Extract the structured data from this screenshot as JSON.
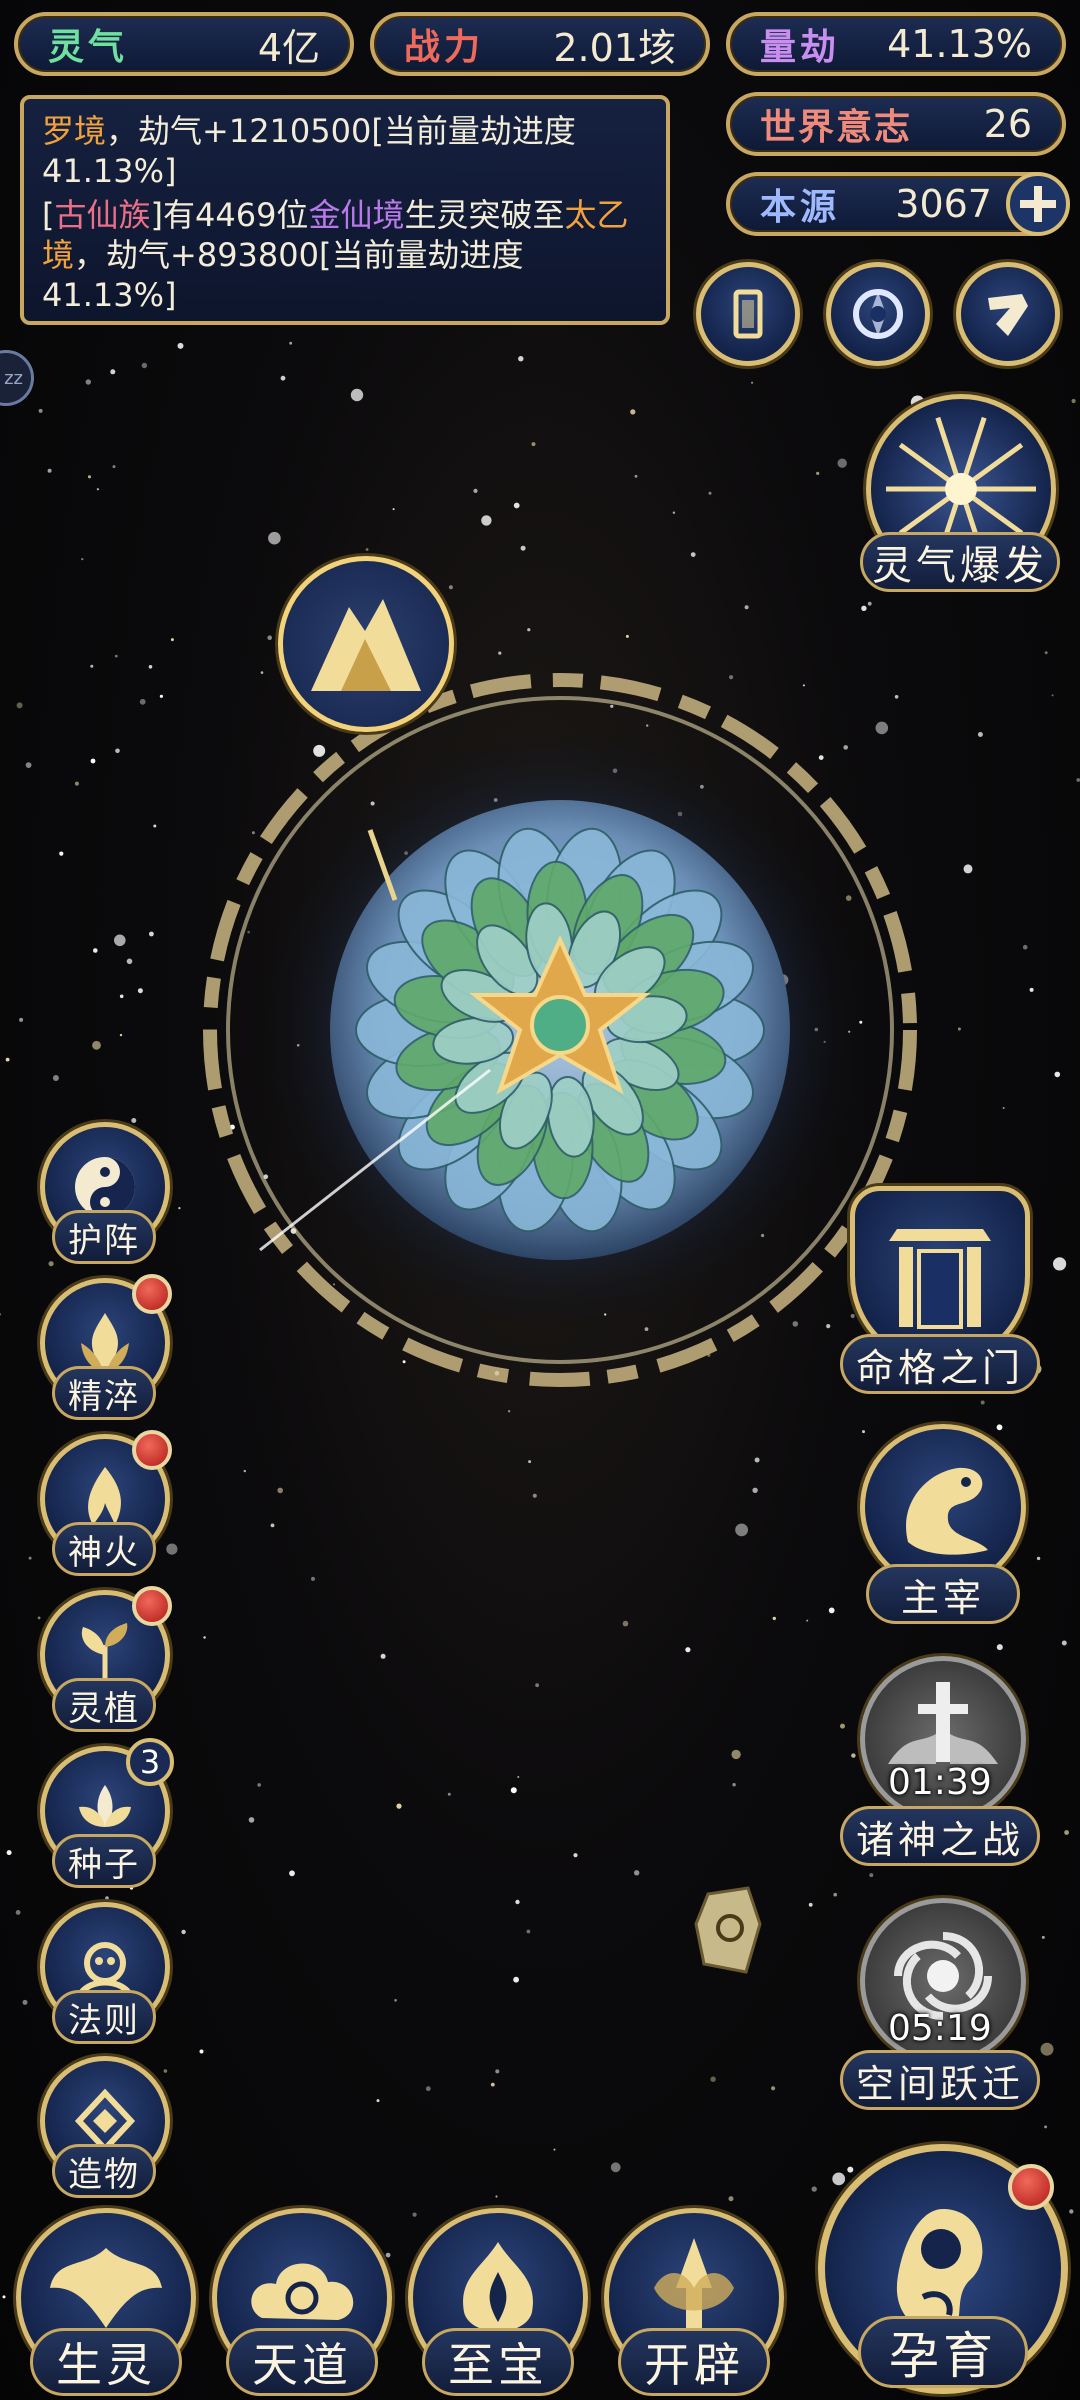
{
  "colors": {
    "gold": "#d9bd72",
    "navy": "#13234a",
    "accent_orange": "#f2a23c",
    "accent_pink": "#ea6f88",
    "accent_purple": "#b77ae8",
    "badge_red": "#c8201c"
  },
  "top_stats": {
    "lingqi": {
      "label": "灵气",
      "value": "4亿"
    },
    "zhanli": {
      "label": "战力",
      "value": "2.01垓"
    },
    "liangjie": {
      "label": "量劫",
      "value": "41.13%"
    },
    "shijie": {
      "label": "世界意志",
      "value": "26"
    },
    "benyuan": {
      "label": "本源",
      "value": "3067",
      "icon": "plus-icon"
    }
  },
  "log": {
    "line1": {
      "place": "罗境",
      "text": "，劫气+1210500[当前量劫进度41.13%]"
    },
    "line2": {
      "open": "[",
      "race": "古仙族",
      "mid": "]有4469位",
      "realm_a": "金仙境",
      "mid2": "生灵突破至",
      "realm_b": "太乙境",
      "tail": "，劫气+893800[当前量劫进度41.13%]"
    }
  },
  "top_icons": [
    "card-icon",
    "portal-icon",
    "scroll-icon"
  ],
  "lingqi_burst": {
    "label": "灵气爆发",
    "icon": "burst-icon"
  },
  "left_menu": [
    {
      "label": "护阵",
      "icon": "yin-yang-icon",
      "dot": false,
      "count": ""
    },
    {
      "label": "精淬",
      "icon": "flame-lotus-icon",
      "dot": true,
      "count": ""
    },
    {
      "label": "神火",
      "icon": "fire-icon",
      "dot": true,
      "count": ""
    },
    {
      "label": "灵植",
      "icon": "plant-icon",
      "dot": true,
      "count": ""
    },
    {
      "label": "种子",
      "icon": "lotus-seed-icon",
      "dot": false,
      "count": "3"
    },
    {
      "label": "法则",
      "icon": "rule-icon",
      "dot": false,
      "count": ""
    },
    {
      "label": "造物",
      "icon": "creation-icon",
      "dot": false,
      "count": ""
    }
  ],
  "right_menu": [
    {
      "label": "命格之门",
      "icon": "gate-icon",
      "timer": ""
    },
    {
      "label": "主宰",
      "icon": "dragon-icon",
      "timer": ""
    },
    {
      "label": "诸神之战",
      "icon": "sword-icon",
      "timer": "01:39"
    },
    {
      "label": "空间跃迁",
      "icon": "vortex-icon",
      "timer": "05:19"
    }
  ],
  "bottom_menu": [
    {
      "label": "生灵",
      "icon": "phoenix-icon"
    },
    {
      "label": "天道",
      "icon": "cloud-icon"
    },
    {
      "label": "至宝",
      "icon": "treasure-icon"
    },
    {
      "label": "开辟",
      "icon": "axe-icon"
    }
  ],
  "yunyu": {
    "label": "孕育",
    "icon": "embryo-icon",
    "dot": true
  },
  "sleep": {
    "label": "zz"
  }
}
